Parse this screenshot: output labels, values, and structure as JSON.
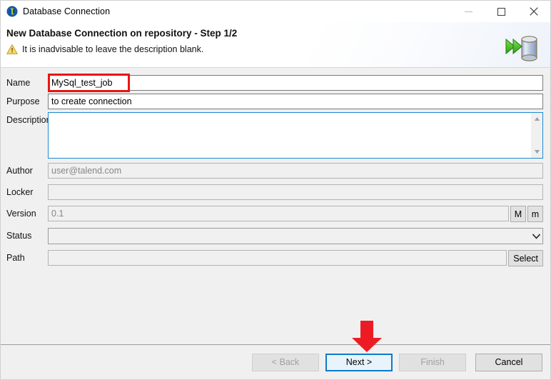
{
  "window": {
    "title": "Database Connection",
    "icon": "talend-circle-icon",
    "controls": {
      "minimize": "minimize-icon",
      "maximize": "maximize-icon",
      "close": "close-icon"
    }
  },
  "header": {
    "title_main": "New Database Connection on repository",
    "title_sep": " - ",
    "title_step": "Step 1/2",
    "message": "It is inadvisable to leave the description blank.",
    "message_icon": "warning-triangle-icon",
    "graphic_icon": "database-import-icon"
  },
  "form": {
    "name": {
      "label": "Name",
      "value": "MySql_test_job",
      "placeholder": "",
      "disabled": false,
      "annotated": true
    },
    "purpose": {
      "label": "Purpose",
      "value": "to create connection",
      "placeholder": "",
      "disabled": false
    },
    "description": {
      "label": "Description",
      "value": "",
      "placeholder": "",
      "disabled": false,
      "focused": true,
      "scrollbar": {
        "up": "scroll-up-icon",
        "down": "scroll-down-icon"
      }
    },
    "author": {
      "label": "Author",
      "value": "user@talend.com",
      "placeholder": "",
      "disabled": true
    },
    "locker": {
      "label": "Locker",
      "value": "",
      "placeholder": "",
      "disabled": true
    },
    "version": {
      "label": "Version",
      "value": "0.1",
      "placeholder": "",
      "disabled": true,
      "major_button": "M",
      "minor_button": "m"
    },
    "status": {
      "label": "Status",
      "value": "",
      "options": [],
      "dropdown_icon": "chevron-down-icon"
    },
    "path": {
      "label": "Path",
      "value": "",
      "placeholder": "",
      "disabled": true,
      "select_button": "Select"
    }
  },
  "footer": {
    "back": {
      "label": "< Back",
      "disabled": true
    },
    "next": {
      "label": "Next >",
      "disabled": false,
      "focused": true
    },
    "finish": {
      "label": "Finish",
      "disabled": true
    },
    "cancel": {
      "label": "Cancel",
      "disabled": false
    }
  },
  "annotations": {
    "name_box_color": "#e81515",
    "arrow_color": "#ed1c24",
    "arrow_target": "Next >"
  },
  "colors": {
    "dialog_bg": "#f0f0f0",
    "field_border": "#7a7a7a",
    "focus_blue": "#1f8ad2",
    "disabled_text": "#868686"
  }
}
